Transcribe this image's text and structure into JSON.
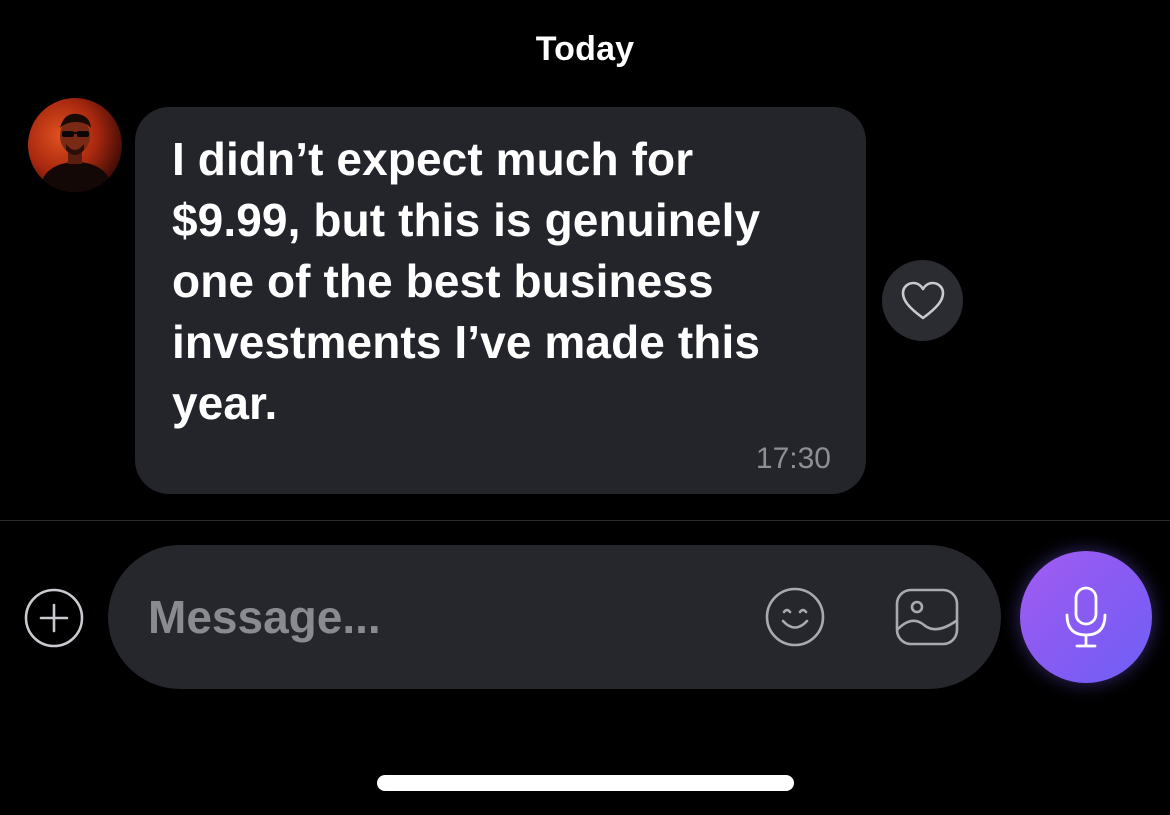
{
  "chat": {
    "date_header": "Today",
    "messages": [
      {
        "text": "I didn’t expect much for\n$9.99, but this is genuinely\none of the best business\ninvestments I’ve made this\nyear.",
        "time": "17:30",
        "reaction_icon": "heart-outline-icon"
      }
    ]
  },
  "composer": {
    "placeholder": "Message...",
    "value": "",
    "icons": {
      "attach": "plus-circle-icon",
      "emoji": "smiley-icon",
      "gallery": "image-icon",
      "mic": "microphone-icon"
    }
  },
  "colors": {
    "background": "#000000",
    "bubble": "#23252b",
    "composer": "#26272c",
    "accent_gradient_start": "#a35cf2",
    "accent_gradient_end": "#6e5ff5"
  }
}
